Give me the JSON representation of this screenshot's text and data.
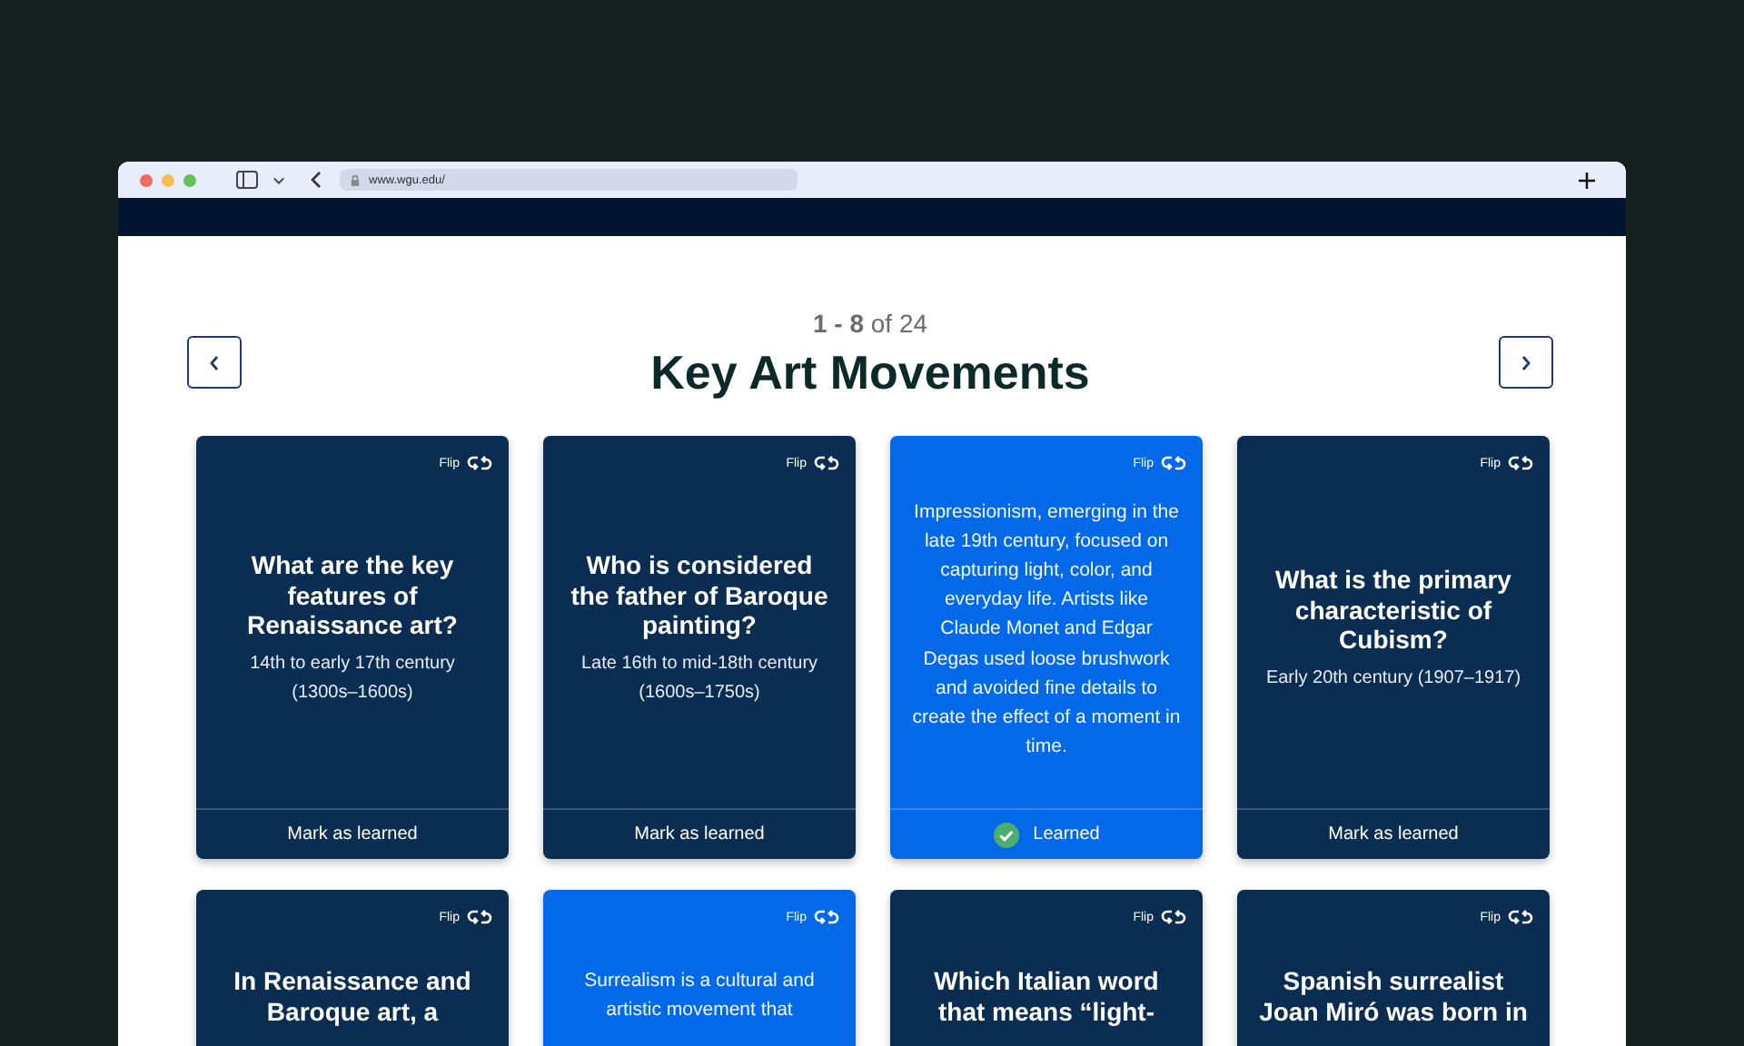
{
  "browser": {
    "url": "www.wgu.edu/"
  },
  "pager": {
    "range": "**1 - 8** of 24",
    "heading": "Key Art Movements"
  },
  "cards": [
    {
      "flipped": false,
      "flip": "Flip",
      "question": "What are the key features of Renaissance art?",
      "period": "14th to early 17th century (1300s–1600s)",
      "footer": {
        "label": "Mark as learned",
        "learned": false
      }
    },
    {
      "flipped": false,
      "flip": "Flip",
      "question": "Who is considered the father of Baroque painting?",
      "period": "Late 16th to mid-18th century (1600s–1750s)",
      "footer": {
        "label": "Mark as learned",
        "learned": false
      }
    },
    {
      "flipped": true,
      "flip": "Flip",
      "answer": "Impressionism, emerging in the late 19th century, focused on capturing light, color, and everyday life. Artists like Claude Monet and Edgar Degas used loose brushwork and avoided fine details to create the effect of a moment in time.",
      "footer": {
        "label": "Learned",
        "learned": true
      }
    },
    {
      "flipped": false,
      "flip": "Flip",
      "question": "What is the primary characteristic of Cubism?",
      "period": "Early 20th century (1907–1917)",
      "footer": {
        "label": "Mark as learned",
        "learned": false
      }
    },
    {
      "flipped": false,
      "flip": "Flip",
      "question": "In Renaissance and Baroque art, a"
    },
    {
      "flipped": true,
      "flip": "Flip",
      "answer": "Surrealism is a cultural and artistic movement that"
    },
    {
      "flipped": false,
      "flip": "Flip",
      "question": "Which Italian word that means “light-"
    },
    {
      "flipped": false,
      "flip": "Flip",
      "question": "Spanish surrealist Joan Miró was born in"
    }
  ]
}
